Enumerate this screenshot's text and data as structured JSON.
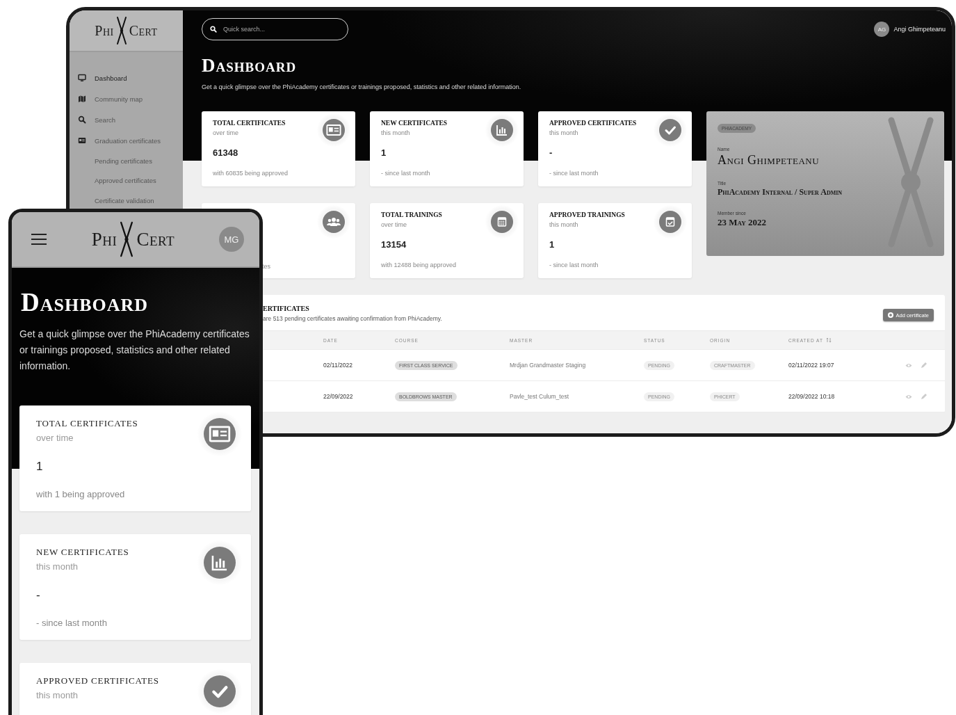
{
  "desktop": {
    "logo": {
      "left": "Phi",
      "right": "Cert"
    },
    "sidebar": {
      "items": [
        {
          "label": "Dashboard",
          "selected": true
        },
        {
          "label": "Community map",
          "selected": false
        },
        {
          "label": "Search",
          "selected": false
        },
        {
          "label": "Graduation certificates",
          "selected": false,
          "children": [
            {
              "label": "Pending certificates",
              "selected": false
            },
            {
              "label": "Approved certificates",
              "selected": false
            },
            {
              "label": "Certificate validation",
              "selected": false
            }
          ]
        }
      ]
    },
    "search": {
      "placeholder": "Quick search..."
    },
    "user": {
      "initials": "AG",
      "name": "Angi Ghimpeteanu"
    },
    "title": "Dashboard",
    "subtitle": "Get a quick glimpse over the PhiAcademy certificates or trainings proposed, statistics and other related information.",
    "stats": [
      {
        "title": "TOTAL CERTIFICATES",
        "subtitle": "over time",
        "value": "61348",
        "footer": "with 60835 being approved"
      },
      {
        "title": "NEW CERTIFICATES",
        "subtitle": "this month",
        "value": "1",
        "footer": "- since last month"
      },
      {
        "title": "APPROVED CERTIFICATES",
        "subtitle": "this month",
        "value": "-",
        "footer": "- since last month"
      },
      {
        "footer": "tes"
      },
      {
        "title": "TOTAL TRAININGS",
        "subtitle": "over time",
        "value": "13154",
        "footer": "with 12488 being approved"
      },
      {
        "title": "APPROVED TRAININGS",
        "subtitle": "this month",
        "value": "1",
        "footer": "- since last month"
      }
    ],
    "profile": {
      "badge": "PHIACADEMY",
      "fields": [
        {
          "label": "Name",
          "value": "Angi Ghimpeteanu"
        },
        {
          "label": "Title",
          "value": "PhiAcademy Internal / Super Admin"
        },
        {
          "label": "Member since",
          "value": "23 May 2022"
        }
      ]
    },
    "table": {
      "heading": "ERTIFICATES",
      "description": "are 513 pending certificates awaiting confirmation from PhiAcademy.",
      "button": "Add certificate",
      "columns": [
        "DATE",
        "COURSE",
        "MASTER",
        "STATUS",
        "ORIGIN",
        "CREATED AT"
      ],
      "rows": [
        {
          "date": "02/11/2022",
          "course": "FIRST CLASS SERVICE",
          "master": "Mrdjan Grandmaster Staging",
          "status": "PENDING",
          "origin": "CRAFTMASTER",
          "created": "02/11/2022 19:07"
        },
        {
          "date": "22/09/2022",
          "course": "BOLDBROWS MASTER",
          "master": "Pavle_test Culum_test",
          "status": "PENDING",
          "origin": "PHICERT",
          "created": "22/09/2022 10:18"
        }
      ]
    }
  },
  "phone": {
    "logo": {
      "left": "Phi",
      "right": "Cert"
    },
    "user": {
      "initials": "MG"
    },
    "title": "Dashboard",
    "subtitle": "Get a quick glimpse over the PhiAcademy certificates or trainings proposed, statistics and other related information.",
    "stats": [
      {
        "title": "TOTAL CERTIFICATES",
        "subtitle": "over time",
        "value": "1",
        "footer": "with 1 being approved"
      },
      {
        "title": "NEW CERTIFICATES",
        "subtitle": "this month",
        "value": "-",
        "footer": "- since last month"
      },
      {
        "title": "APPROVED CERTIFICATES",
        "subtitle": "this month"
      }
    ]
  }
}
